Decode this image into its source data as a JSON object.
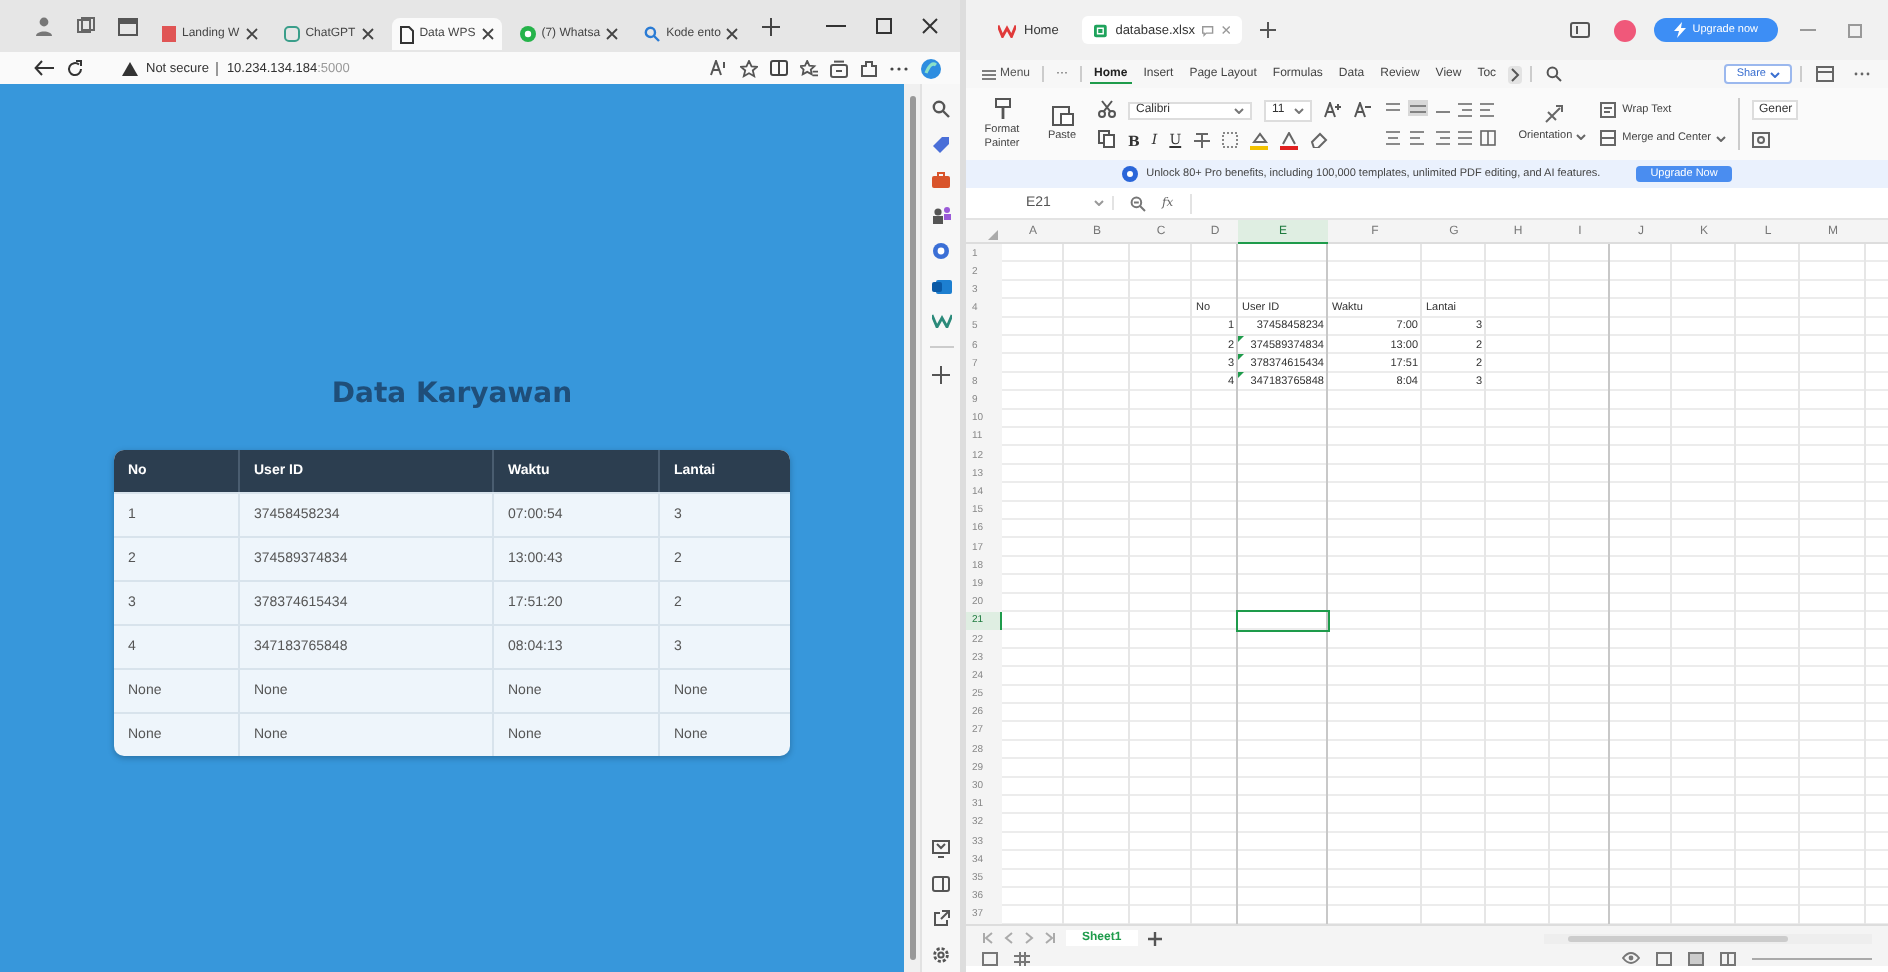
{
  "browser": {
    "tabs": [
      {
        "label": "Landing W",
        "selected": false,
        "kind": "landing"
      },
      {
        "label": "ChatGPT",
        "selected": false,
        "kind": "chatgpt"
      },
      {
        "label": "Data WPS",
        "selected": true,
        "kind": "page"
      },
      {
        "label": "(7) Whatsa",
        "selected": false,
        "kind": "whatsapp"
      },
      {
        "label": "Kode ento",
        "selected": false,
        "kind": "search"
      }
    ],
    "address": {
      "security": "Not secure",
      "host": "10.234.134.184",
      "port": ":5000"
    }
  },
  "page": {
    "title": "Data Karyawan",
    "table": {
      "columns": [
        "No",
        "User ID",
        "Waktu",
        "Lantai"
      ],
      "rows": [
        [
          "1",
          "37458458234",
          "07:00:54",
          "3"
        ],
        [
          "2",
          "374589374834",
          "13:00:43",
          "2"
        ],
        [
          "3",
          "378374615434",
          "17:51:20",
          "2"
        ],
        [
          "4",
          "347183765848",
          "08:04:13",
          "3"
        ],
        [
          "None",
          "None",
          "None",
          "None"
        ],
        [
          "None",
          "None",
          "None",
          "None"
        ]
      ]
    }
  },
  "spreadsheet": {
    "tabs": [
      {
        "label": "Home",
        "selected": false,
        "kind": "home"
      },
      {
        "label": "database.xlsx",
        "selected": true,
        "kind": "sheet"
      }
    ],
    "upgrade_button": "Upgrade now",
    "menu_button": "Menu",
    "more": "···",
    "ribbon_tabs": [
      {
        "label": "Home",
        "selected": true
      },
      {
        "label": "Insert",
        "selected": false
      },
      {
        "label": "Page Layout",
        "selected": false
      },
      {
        "label": "Formulas",
        "selected": false
      },
      {
        "label": "Data",
        "selected": false
      },
      {
        "label": "Review",
        "selected": false
      },
      {
        "label": "View",
        "selected": false
      },
      {
        "label": "Toc",
        "selected": false
      }
    ],
    "share_button": "Share",
    "ribbon": {
      "format_painter": "Format Painter",
      "paste": "Paste",
      "font": "Calibri",
      "size": "11",
      "styles": [
        "B",
        "I",
        "U"
      ],
      "orientation": "Orientation",
      "wrap_text": "Wrap Text",
      "merge": "Merge and Center",
      "number_format": "Gener"
    },
    "banner": {
      "text": "Unlock 80+ Pro benefits, including 100,000 templates, unlimited PDF editing, and AI features.",
      "button": "Upgrade Now"
    },
    "name_box": "E21",
    "formula_icon": "fx",
    "columns": [
      {
        "label": "A",
        "selected": false
      },
      {
        "label": "B",
        "selected": false
      },
      {
        "label": "C",
        "selected": false
      },
      {
        "label": "D",
        "selected": false
      },
      {
        "label": "E",
        "selected": true
      },
      {
        "label": "F",
        "selected": false
      },
      {
        "label": "G",
        "selected": false
      },
      {
        "label": "H",
        "selected": false
      },
      {
        "label": "I",
        "selected": false
      },
      {
        "label": "J",
        "selected": false
      },
      {
        "label": "K",
        "selected": false
      },
      {
        "label": "L",
        "selected": false
      },
      {
        "label": "M",
        "selected": false
      }
    ],
    "rows": [
      {
        "label": "1",
        "selected": false
      },
      {
        "label": "2",
        "selected": false
      },
      {
        "label": "3",
        "selected": false
      },
      {
        "label": "4",
        "selected": false,
        "cells": {
          "D": {
            "value": "No",
            "kind": "text",
            "flagged": false
          },
          "E": {
            "value": "User ID",
            "kind": "text",
            "flagged": false
          },
          "F": {
            "value": "Waktu",
            "kind": "text",
            "flagged": false
          },
          "G": {
            "value": "Lantai",
            "kind": "text",
            "flagged": false
          }
        }
      },
      {
        "label": "5",
        "selected": false,
        "cells": {
          "D": {
            "value": "1",
            "kind": "number",
            "flagged": false
          },
          "E": {
            "value": "37458458234",
            "kind": "number",
            "flagged": false
          },
          "F": {
            "value": "7:00",
            "kind": "number",
            "flagged": false
          },
          "G": {
            "value": "3",
            "kind": "number",
            "flagged": false
          }
        }
      },
      {
        "label": "6",
        "selected": false,
        "cells": {
          "D": {
            "value": "2",
            "kind": "number",
            "flagged": false
          },
          "E": {
            "value": "374589374834",
            "kind": "number",
            "flagged": true
          },
          "F": {
            "value": "13:00",
            "kind": "number",
            "flagged": false
          },
          "G": {
            "value": "2",
            "kind": "number",
            "flagged": false
          }
        }
      },
      {
        "label": "7",
        "selected": false,
        "cells": {
          "D": {
            "value": "3",
            "kind": "number",
            "flagged": false
          },
          "E": {
            "value": "378374615434",
            "kind": "number",
            "flagged": true
          },
          "F": {
            "value": "17:51",
            "kind": "number",
            "flagged": false
          },
          "G": {
            "value": "2",
            "kind": "number",
            "flagged": false
          }
        }
      },
      {
        "label": "8",
        "selected": false,
        "cells": {
          "D": {
            "value": "4",
            "kind": "number",
            "flagged": false
          },
          "E": {
            "value": "347183765848",
            "kind": "number",
            "flagged": true
          },
          "F": {
            "value": "8:04",
            "kind": "number",
            "flagged": false
          },
          "G": {
            "value": "3",
            "kind": "number",
            "flagged": false
          }
        }
      },
      {
        "label": "9",
        "selected": false
      },
      {
        "label": "10",
        "selected": false
      },
      {
        "label": "11",
        "selected": false
      },
      {
        "label": "12",
        "selected": false
      },
      {
        "label": "13",
        "selected": false
      },
      {
        "label": "14",
        "selected": false
      },
      {
        "label": "15",
        "selected": false
      },
      {
        "label": "16",
        "selected": false
      },
      {
        "label": "17",
        "selected": false
      },
      {
        "label": "18",
        "selected": false
      },
      {
        "label": "19",
        "selected": false
      },
      {
        "label": "20",
        "selected": false
      },
      {
        "label": "21",
        "selected": true
      },
      {
        "label": "22",
        "selected": false
      },
      {
        "label": "23",
        "selected": false
      },
      {
        "label": "24",
        "selected": false
      },
      {
        "label": "25",
        "selected": false
      },
      {
        "label": "26",
        "selected": false
      },
      {
        "label": "27",
        "selected": false
      },
      {
        "label": "28",
        "selected": false
      },
      {
        "label": "29",
        "selected": false
      },
      {
        "label": "30",
        "selected": false
      },
      {
        "label": "31",
        "selected": false
      },
      {
        "label": "32",
        "selected": false
      },
      {
        "label": "33",
        "selected": false
      },
      {
        "label": "34",
        "selected": false
      },
      {
        "label": "35",
        "selected": false
      },
      {
        "label": "36",
        "selected": false
      },
      {
        "label": "37",
        "selected": false
      }
    ],
    "sheet_tabs": [
      {
        "label": "Sheet1",
        "selected": true
      }
    ]
  }
}
